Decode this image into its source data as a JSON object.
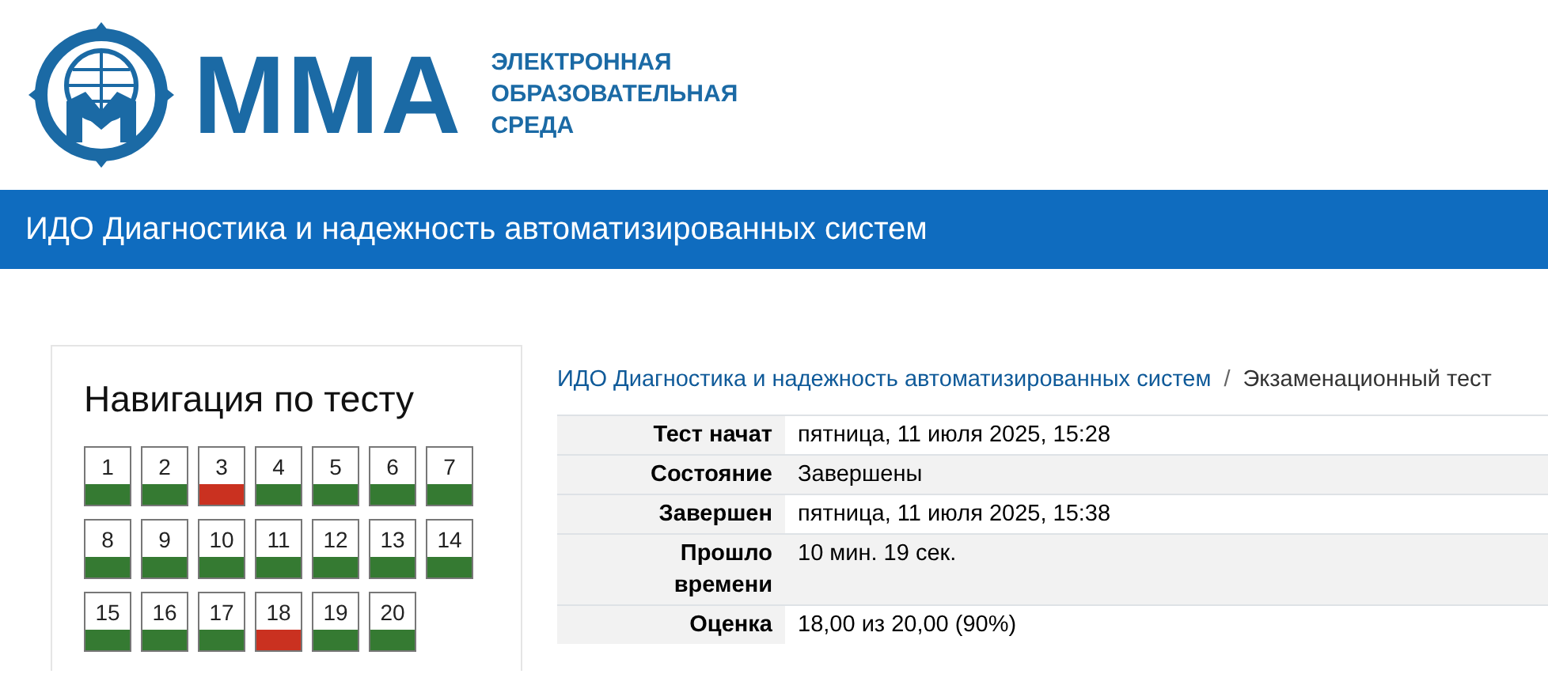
{
  "logo": {
    "mark": "ММА",
    "lines": [
      "ЭЛЕКТРОННАЯ",
      "ОБРАЗОВАТЕЛЬНАЯ",
      "СРЕДА"
    ]
  },
  "course_bar": {
    "title": "ИДО Диагностика и надежность автоматизированных систем"
  },
  "navigation": {
    "title": "Навигация по тесту",
    "questions": [
      {
        "number": "1",
        "correct": true
      },
      {
        "number": "2",
        "correct": true
      },
      {
        "number": "3",
        "correct": false
      },
      {
        "number": "4",
        "correct": true
      },
      {
        "number": "5",
        "correct": true
      },
      {
        "number": "6",
        "correct": true
      },
      {
        "number": "7",
        "correct": true
      },
      {
        "number": "8",
        "correct": true
      },
      {
        "number": "9",
        "correct": true
      },
      {
        "number": "10",
        "correct": true
      },
      {
        "number": "11",
        "correct": true
      },
      {
        "number": "12",
        "correct": true
      },
      {
        "number": "13",
        "correct": true
      },
      {
        "number": "14",
        "correct": true
      },
      {
        "number": "15",
        "correct": true
      },
      {
        "number": "16",
        "correct": true
      },
      {
        "number": "17",
        "correct": true
      },
      {
        "number": "18",
        "correct": false
      },
      {
        "number": "19",
        "correct": true
      },
      {
        "number": "20",
        "correct": true
      }
    ]
  },
  "breadcrumb": [
    {
      "label": "ИДО Диагностика и надежность автоматизированных систем",
      "kind": "link"
    },
    {
      "label": "/",
      "kind": "separator"
    },
    {
      "label": "Экзаменационный тест",
      "kind": "current"
    }
  ],
  "summary": [
    {
      "label": "Тест начат",
      "value": "пятница, 11 июля 2025, 15:28"
    },
    {
      "label": "Состояние",
      "value": "Завершены"
    },
    {
      "label": "Завершен",
      "value": "пятница, 11 июля 2025, 15:38"
    },
    {
      "label": "Прошло времени",
      "value": "10 мин. 19 сек."
    },
    {
      "label": "Оценка",
      "value": "18,00 из 20,00 (90%)"
    }
  ]
}
